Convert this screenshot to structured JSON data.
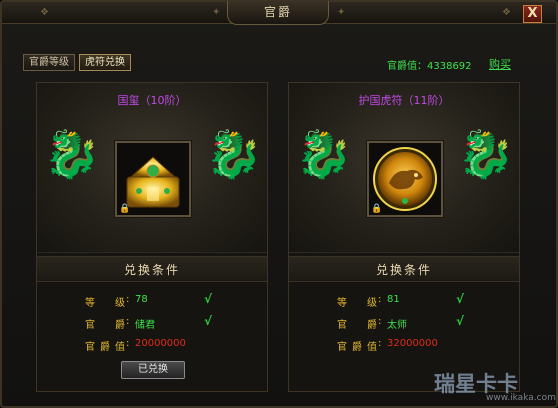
{
  "window": {
    "title": "官爵",
    "close_label": "X"
  },
  "tabs": [
    {
      "label": "官爵等级",
      "active": false
    },
    {
      "label": "虎符兑换",
      "active": true
    }
  ],
  "header": {
    "rank_value_label": "官爵值：4338692",
    "redeem_label": "购买"
  },
  "panels": [
    {
      "title": "国玺（10阶）",
      "item_icon": "imperial-seal-icon",
      "section_title": "兑换条件",
      "requirements": [
        {
          "label": "等级",
          "value": "78",
          "value_color": "#3ee04a",
          "met": true
        },
        {
          "label": "官爵",
          "value": "储君",
          "value_color": "#3ee04a",
          "met": true
        },
        {
          "label": "官爵值",
          "value": "20000000",
          "value_color": "#e02a1c",
          "met": false
        }
      ],
      "check_mark": "√",
      "button_label": "已兑换"
    },
    {
      "title": "护国虎符（11阶）",
      "item_icon": "tiger-tally-icon",
      "section_title": "兑换条件",
      "requirements": [
        {
          "label": "等级",
          "value": "81",
          "value_color": "#3ee04a",
          "met": true
        },
        {
          "label": "官爵",
          "value": "太师",
          "value_color": "#3ee04a",
          "met": true
        },
        {
          "label": "官爵值",
          "value": "32000000",
          "value_color": "#e02a1c",
          "met": false
        }
      ],
      "check_mark": "√"
    }
  ],
  "watermark": {
    "logo": "瑞星卡卡",
    "url": "www.ikaka.com"
  },
  "colors": {
    "accent_green": "#3ee04a",
    "title_purple": "#c14ae6",
    "label_gold": "#e0b72f",
    "value_red": "#e02a1c"
  }
}
